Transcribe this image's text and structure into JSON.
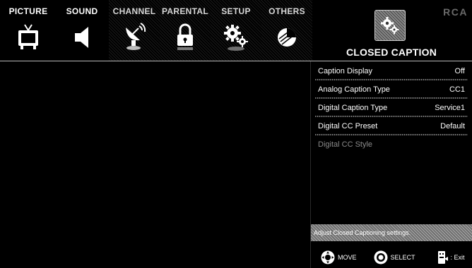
{
  "brand": "RCA",
  "tabs": [
    {
      "label": "PICTURE",
      "icon": "tv-icon"
    },
    {
      "label": "SOUND",
      "icon": "speaker-icon"
    },
    {
      "label": "CHANNEL",
      "icon": "satellite-dish-icon"
    },
    {
      "label": "PARENTAL",
      "icon": "lock-icon"
    },
    {
      "label": "SETUP",
      "icon": "gears-icon"
    },
    {
      "label": "OTHERS",
      "icon": "pie-icon"
    }
  ],
  "header": {
    "title": "CLOSED CAPTION",
    "icon": "gears-icon"
  },
  "settings": [
    {
      "label": "Caption Display",
      "value": "Off"
    },
    {
      "label": "Analog Caption Type",
      "value": "CC1"
    },
    {
      "label": "Digital Caption Type",
      "value": "Service1"
    },
    {
      "label": "Digital CC Preset",
      "value": "Default"
    },
    {
      "label": "Digital CC Style",
      "value": ""
    }
  ],
  "help_text": "Adjust Closed Captioning settings.",
  "footer": {
    "move": "MOVE",
    "select": "SELECT",
    "exit": ": Exit"
  }
}
